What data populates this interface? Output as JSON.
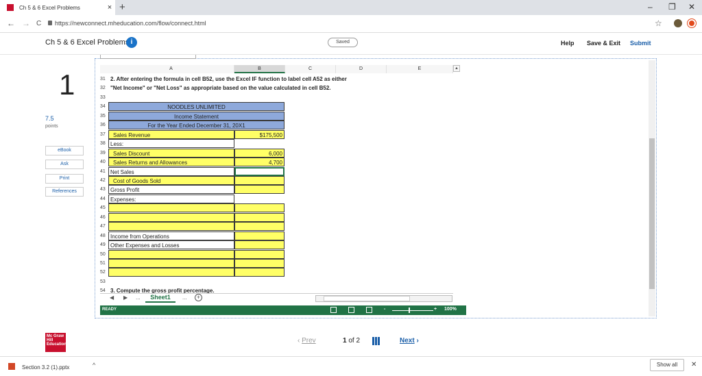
{
  "browser": {
    "tab_title": "Ch 5 & 6 Excel Problems",
    "tab_close": "×",
    "new_tab": "+",
    "url": "https://newconnect.mheducation.com/flow/connect.html",
    "win_min": "–",
    "win_max": "❐",
    "win_close": "✕",
    "back": "←",
    "forward": "→",
    "reload": "C",
    "star": "☆"
  },
  "header": {
    "title": "Ch 5 & 6 Excel Problems",
    "info": "i",
    "saved": "Saved",
    "help": "Help",
    "save_exit": "Save & Exit",
    "submit": "Submit"
  },
  "rail": {
    "question_number": "1",
    "points_value": "7.5",
    "points_label": "points",
    "ebook": "eBook",
    "ask": "Ask",
    "print": "Print",
    "references": "References"
  },
  "sheet": {
    "columns": [
      "A",
      "B",
      "C",
      "D",
      "E"
    ],
    "rows": [
      {
        "n": "31",
        "a": "2. After entering the formula in cell B52, use the Excel IF function to label cell A52 as either"
      },
      {
        "n": "32",
        "a": "\"Net Income\" or \"Net Loss\" as appropriate based on the value calculated in cell B52."
      },
      {
        "n": "33",
        "a": ""
      },
      {
        "n": "34",
        "a": "NOODLES UNLIMITED"
      },
      {
        "n": "35",
        "a": "Income Statement"
      },
      {
        "n": "36",
        "a": "For the Year Ended December 31, 20X1"
      },
      {
        "n": "37",
        "a": "Sales Revenue",
        "b": "$175,500"
      },
      {
        "n": "38",
        "a": "Less:"
      },
      {
        "n": "39",
        "a": "Sales Discount",
        "b": "6,000"
      },
      {
        "n": "40",
        "a": "Sales Returns and Allowances",
        "b": "4,700"
      },
      {
        "n": "41",
        "a": "Net Sales"
      },
      {
        "n": "42",
        "a": "Cost of Goods Sold"
      },
      {
        "n": "43",
        "a": "Gross Profit"
      },
      {
        "n": "44",
        "a": "Expenses:"
      },
      {
        "n": "45",
        "a": ""
      },
      {
        "n": "46",
        "a": ""
      },
      {
        "n": "47",
        "a": ""
      },
      {
        "n": "48",
        "a": "Income from Operations"
      },
      {
        "n": "49",
        "a": "Other Expenses and Losses"
      },
      {
        "n": "50",
        "a": ""
      },
      {
        "n": "51",
        "a": ""
      },
      {
        "n": "52",
        "a": ""
      },
      {
        "n": "53",
        "a": ""
      },
      {
        "n": "54",
        "a": "3. Compute the gross profit percentage."
      }
    ],
    "sheet_tab": "Sheet1",
    "tab_ellipsis": "...",
    "add_sheet": "+",
    "status": "READY",
    "zoom_minus": "-",
    "zoom_plus": "+",
    "zoom": "100%"
  },
  "footer": {
    "logo": "Mc Graw Hill Education",
    "prev": "Prev",
    "page_current": "1",
    "page_of": "of",
    "page_total": "2",
    "next": "Next"
  },
  "downloads": {
    "file": "Section 3.2 (1).pptx",
    "show_all": "Show all"
  }
}
